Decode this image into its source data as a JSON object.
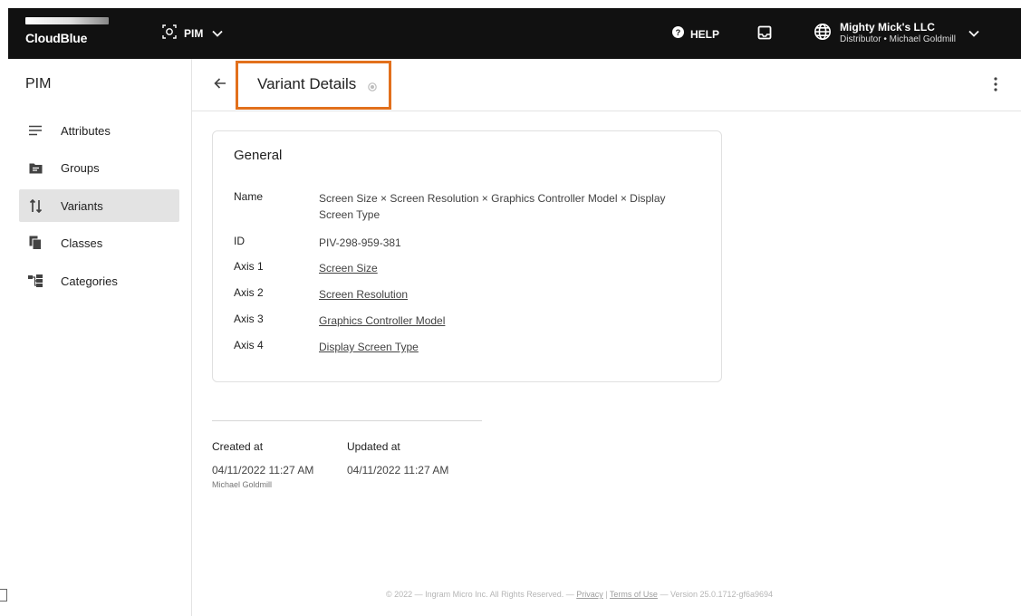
{
  "topbar": {
    "logo_text": "CloudBlue",
    "module_label": "PIM",
    "help_label": "HELP",
    "account_name": "Mighty Mick's LLC",
    "account_sub": "Distributor • Michael Goldmill",
    "icons": {
      "module": "pim-module-icon",
      "help": "help-circle-icon",
      "inbox": "inbox-icon",
      "account": "globe-icon",
      "chevron": "chevron-down-icon"
    }
  },
  "sidebar": {
    "title": "PIM",
    "items": [
      {
        "label": "Attributes",
        "icon": "list-icon",
        "active": false
      },
      {
        "label": "Groups",
        "icon": "folder-icon",
        "active": false
      },
      {
        "label": "Variants",
        "icon": "variants-icon",
        "active": true
      },
      {
        "label": "Classes",
        "icon": "copy-icon",
        "active": false
      },
      {
        "label": "Categories",
        "icon": "hierarchy-icon",
        "active": false
      }
    ]
  },
  "header": {
    "title": "Variant Details",
    "highlight_color": "#e2701c"
  },
  "card": {
    "title": "General",
    "fields": [
      {
        "label": "Name",
        "value": "Screen Size × Screen Resolution × Graphics Controller Model × Display Screen Type",
        "link": false
      },
      {
        "label": "ID",
        "value": "PIV-298-959-381",
        "link": false
      },
      {
        "label": "Axis 1",
        "value": "Screen Size",
        "link": true
      },
      {
        "label": "Axis 2",
        "value": "Screen Resolution",
        "link": true
      },
      {
        "label": "Axis 3",
        "value": "Graphics Controller Model",
        "link": true
      },
      {
        "label": "Axis 4",
        "value": "Display Screen Type",
        "link": true
      }
    ]
  },
  "meta": {
    "created_label": "Created at",
    "created_value": "04/11/2022 11:27 AM",
    "created_by": "Michael Goldmill",
    "updated_label": "Updated at",
    "updated_value": "04/11/2022 11:27 AM"
  },
  "footer": {
    "prefix": "© 2022 — Ingram Micro Inc. All Rights Reserved. — ",
    "privacy": "Privacy",
    "sep": " | ",
    "terms": "Terms of Use",
    "version": " — Version 25.0.1712-gf6a9694"
  }
}
